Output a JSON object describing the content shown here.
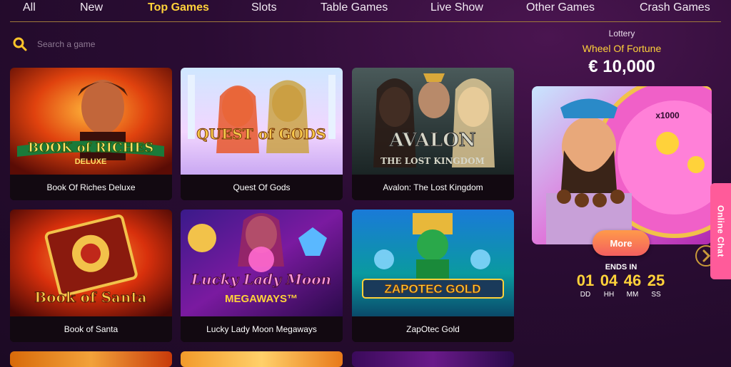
{
  "nav": {
    "tabs": [
      {
        "label": "All"
      },
      {
        "label": "New"
      },
      {
        "label": "Top Games",
        "active": true
      },
      {
        "label": "Slots"
      },
      {
        "label": "Table Games"
      },
      {
        "label": "Live Show"
      },
      {
        "label": "Other Games"
      },
      {
        "label": "Crash Games"
      }
    ]
  },
  "search": {
    "placeholder": "Search a game",
    "icon": "search-icon"
  },
  "games": [
    {
      "title": "Book Of Riches Deluxe",
      "logo": "BOOK of RICHES",
      "sublogo": "DELUXE"
    },
    {
      "title": "Quest Of Gods",
      "logo": "QUEST of GODS",
      "sublogo": ""
    },
    {
      "title": "Avalon: The Lost Kingdom",
      "logo": "AVALON",
      "sublogo": "THE LOST KINGDOM"
    },
    {
      "title": "Book of Santa",
      "logo": "Book of Santa",
      "sublogo": ""
    },
    {
      "title": "Lucky Lady Moon Megaways",
      "logo": "Lucky Lady Moon",
      "sublogo": "MEGAWAYS™"
    },
    {
      "title": "ZapOtec Gold",
      "logo": "ZAPOTEC GOLD",
      "sublogo": ""
    }
  ],
  "lottery": {
    "kicker": "Lottery",
    "game_name": "Wheel Of Fortune",
    "amount": "€ 10,000",
    "multiplier": "x1000",
    "more_label": "More",
    "ends_label": "ENDS IN",
    "countdown": [
      {
        "value": "01",
        "unit": "DD"
      },
      {
        "value": "04",
        "unit": "HH"
      },
      {
        "value": "46",
        "unit": "MM"
      },
      {
        "value": "25",
        "unit": "SS"
      }
    ]
  },
  "chat": {
    "label": "Online Chat"
  },
  "colors": {
    "accent": "#ffd23a",
    "chat": "#ff5b9a",
    "background": "#2a0c33"
  }
}
